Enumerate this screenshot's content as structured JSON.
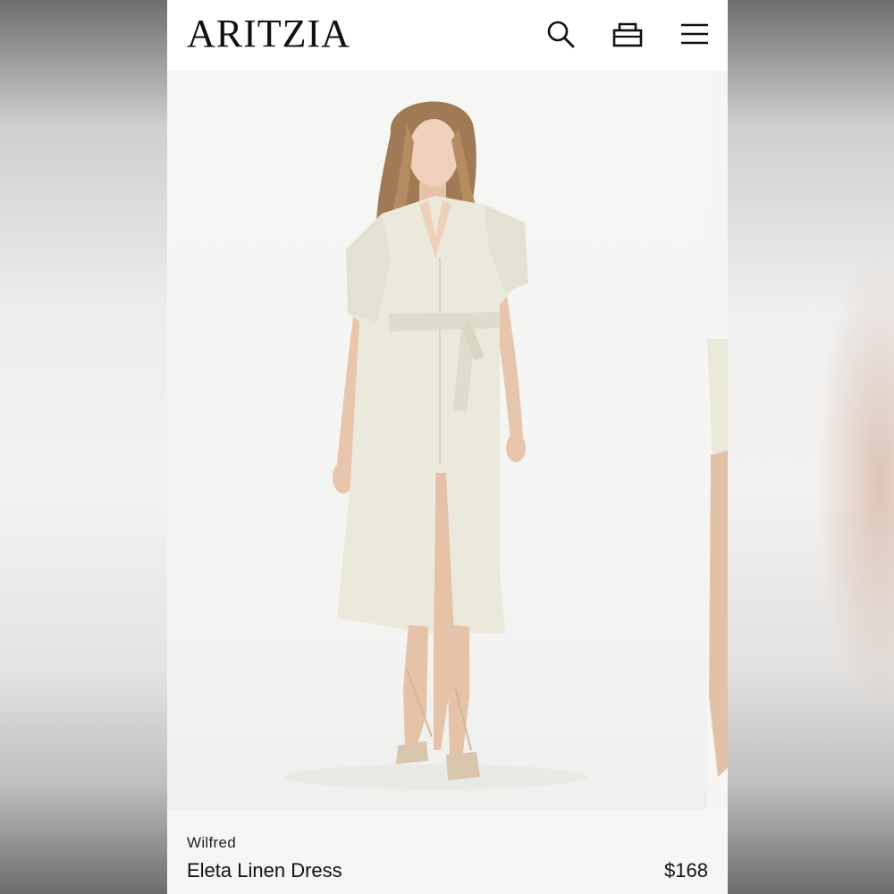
{
  "header": {
    "logo": "ARITZIA",
    "icons": [
      "search-icon",
      "shopping-bag-icon",
      "hamburger-menu-icon"
    ]
  },
  "product": {
    "brand": "Wilfred",
    "name": "Eleta Linen Dress",
    "price": "$168",
    "image": "model-wearing-cream-linen-shirt-dress"
  },
  "colors": {
    "background": "#ffffff",
    "dress": "#ebe9dc",
    "info_strip": "#f6f6f6"
  }
}
